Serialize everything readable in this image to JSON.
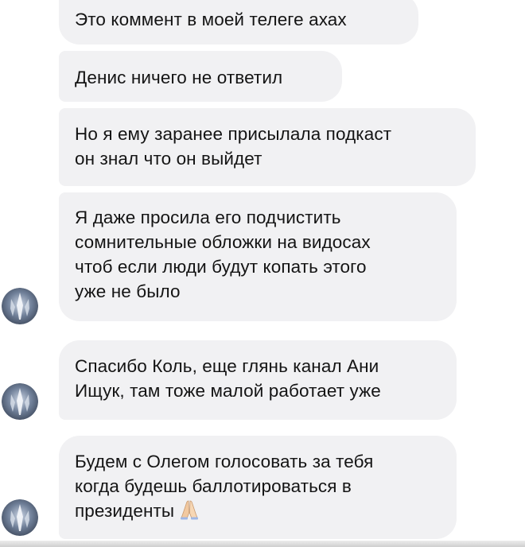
{
  "messages": [
    {
      "lines": [
        "Это коммент в моей телеге ахах"
      ]
    },
    {
      "lines": [
        "Денис ничего не ответил"
      ]
    },
    {
      "lines": [
        "Но я ему заранее присылала подкаст",
        "он знал что он выйдет"
      ]
    },
    {
      "lines": [
        "Я даже просила его подчистить",
        "сомнительные обложки на видосах",
        "чтоб если люди будут копать этого",
        "уже не было"
      ]
    },
    {
      "lines": [
        "Спасибо Коль, еще глянь канал Ани",
        "Ищук, там тоже малой работает уже"
      ]
    },
    {
      "lines": [
        "Будем с Олегом голосовать за тебя",
        "когда будешь баллотироваться в",
        "президенты"
      ],
      "trailing_emoji": "folded-hands-icon"
    }
  ],
  "avatar": {
    "icon": "avatar-icon"
  },
  "colors": {
    "bubble_bg": "#f1f1f3",
    "text": "#141414",
    "avatar_bg": "#5f6f86"
  }
}
